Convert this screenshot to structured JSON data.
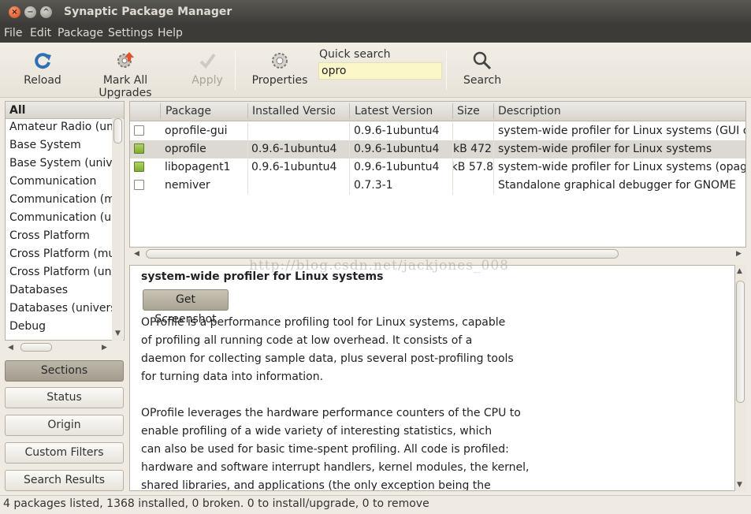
{
  "window": {
    "title": "Synaptic Package Manager",
    "controls": {
      "close": "×",
      "minimize": "−",
      "maximize": "^"
    }
  },
  "menu": [
    "File",
    "Edit",
    "Package",
    "Settings",
    "Help"
  ],
  "toolbar": {
    "reload": "Reload",
    "mark_all_upgrades": "Mark All Upgrades",
    "apply": "Apply",
    "properties": "Properties",
    "quick_search_label": "Quick search",
    "quick_search_value": "opro",
    "search": "Search"
  },
  "sections": {
    "header": "All",
    "items": [
      "Amateur Radio (univ",
      "Base System",
      "Base System (unive",
      "Communication",
      "Communication (mu",
      "Communication (uni",
      "Cross Platform",
      "Cross Platform (mul",
      "Cross Platform (univ",
      "Databases",
      "Databases (universe",
      "Debug"
    ]
  },
  "filter_buttons": [
    "Sections",
    "Status",
    "Origin",
    "Custom Filters",
    "Search Results"
  ],
  "packages": {
    "columns": [
      "",
      "Package",
      "Installed Version",
      "Latest Version",
      "Size",
      "Description"
    ],
    "rows": [
      {
        "package": "oprofile-gui",
        "installed": "",
        "latest": "0.9.6-1ubuntu4",
        "size": "",
        "description": "system-wide profiler for Linux systems (GUI con",
        "status": "not-installed",
        "selected": false
      },
      {
        "package": "oprofile",
        "installed": "0.9.6-1ubuntu4",
        "latest": "0.9.6-1ubuntu4",
        "size": "472 kB",
        "description": "system-wide profiler for Linux systems",
        "status": "installed",
        "selected": true
      },
      {
        "package": "libopagent1",
        "installed": "0.9.6-1ubuntu4",
        "latest": "0.9.6-1ubuntu4",
        "size": "57.8 kB",
        "description": "system-wide profiler for Linux systems (opagent",
        "status": "installed",
        "selected": false
      },
      {
        "package": "nemiver",
        "installed": "",
        "latest": "0.7.3-1",
        "size": "",
        "description": "Standalone graphical debugger for GNOME",
        "status": "not-installed",
        "selected": false
      }
    ]
  },
  "watermark": "http://blog.csdn.net/jackjones_008",
  "description": {
    "title": "system-wide profiler for Linux systems",
    "screenshot_button": "Get Screenshot",
    "lines": [
      "OProfile is a performance profiling tool for Linux systems, capable",
      "of profiling all running code at low overhead.  It consists of a",
      "daemon for collecting sample data, plus several post-profiling tools",
      "for turning data into information.",
      "",
      "OProfile leverages the hardware performance counters of the CPU to",
      "enable profiling of a wide variety of interesting statistics, which",
      "can also be used for basic time-spent profiling. All code is profiled:",
      "hardware and software interrupt handlers, kernel modules, the kernel,",
      "shared libraries, and applications (the only exception being the"
    ]
  },
  "status": "4 packages listed, 1368 installed, 0 broken. 0 to install/upgrade, 0 to remove",
  "colors": {
    "titlebar": "#3c3b37",
    "quick_search_bg": "#fbf7c8",
    "installed_checkbox": "#8fbc3a",
    "active_filter": "#aaa396"
  }
}
